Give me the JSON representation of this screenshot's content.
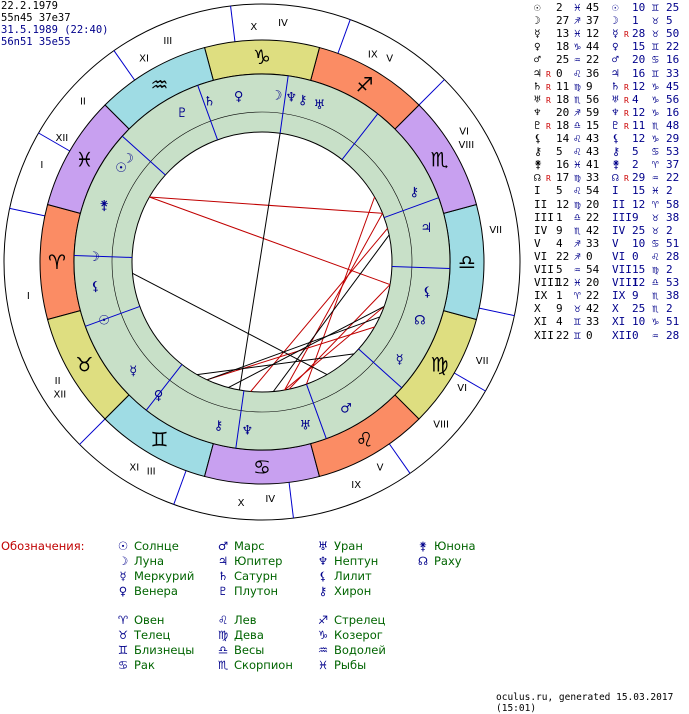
{
  "header": {
    "line1": "22.2.1979",
    "line2": "55n45 37e37",
    "line3": "31.5.1989 (22:40)",
    "line4": "56n51 35e55"
  },
  "colors": {
    "fire": "#fb8c64",
    "earth": "#dede80",
    "air": "#9fdce4",
    "water": "#c8a0f0",
    "house_ring": "#c8e0c8",
    "aspect_red": "#c00000",
    "aspect_black": "#000000",
    "legend_title": "#c00000",
    "legend_name": "#006400",
    "glyph": "#00008b"
  },
  "zodiac": [
    {
      "sign": "aries",
      "glyph": "♈",
      "element": "fire"
    },
    {
      "sign": "taurus",
      "glyph": "♉",
      "element": "earth"
    },
    {
      "sign": "gemini",
      "glyph": "♊",
      "element": "air"
    },
    {
      "sign": "cancer",
      "glyph": "♋",
      "element": "water"
    },
    {
      "sign": "leo",
      "glyph": "♌",
      "element": "fire"
    },
    {
      "sign": "virgo",
      "glyph": "♍",
      "element": "earth"
    },
    {
      "sign": "libra",
      "glyph": "♎",
      "element": "air"
    },
    {
      "sign": "scorpio",
      "glyph": "♏",
      "element": "water"
    },
    {
      "sign": "sagittarius",
      "glyph": "♐",
      "element": "fire"
    },
    {
      "sign": "capricorn",
      "glyph": "♑",
      "element": "earth"
    },
    {
      "sign": "aquarius",
      "glyph": "♒",
      "element": "air"
    },
    {
      "sign": "pisces",
      "glyph": "♓",
      "element": "water"
    }
  ],
  "outer_house_labels": [
    "I",
    "II",
    "III",
    "IV",
    "V",
    "VI",
    "VII",
    "VIII",
    "IX",
    "X",
    "XI",
    "XII"
  ],
  "inner_house_labels": [
    "I",
    "II",
    "III",
    "IV",
    "V",
    "VI",
    "VII",
    "VIII",
    "IX",
    "X",
    "XI",
    "XII"
  ],
  "inner_planets": [
    {
      "name": "sun",
      "glyph": "☉"
    },
    {
      "name": "moon",
      "glyph": "☽"
    },
    {
      "name": "mercury",
      "glyph": "☿"
    },
    {
      "name": "venus",
      "glyph": "♀"
    },
    {
      "name": "mars",
      "glyph": "♂"
    },
    {
      "name": "jupiter",
      "glyph": "♃"
    },
    {
      "name": "saturn",
      "glyph": "♄"
    },
    {
      "name": "uranus",
      "glyph": "♅"
    },
    {
      "name": "neptune",
      "glyph": "♆"
    },
    {
      "name": "pluto",
      "glyph": "♇"
    },
    {
      "name": "chiron",
      "glyph": "⚷"
    },
    {
      "name": "node",
      "glyph": "☊"
    },
    {
      "name": "juno",
      "glyph": "⚵"
    },
    {
      "name": "lilith",
      "glyph": "⚸"
    }
  ],
  "table": [
    {
      "g": "☉",
      "r": "",
      "d1": "2",
      "s1": "♓",
      "m1": "45",
      "g2": "☉",
      "r2": "",
      "d2": "10",
      "s2": "♊",
      "m2": "25"
    },
    {
      "g": "☽",
      "r": "",
      "d1": "27",
      "s1": "♐",
      "m1": "37",
      "g2": "☽",
      "r2": "",
      "d2": "1",
      "s2": "♉",
      "m2": "5"
    },
    {
      "g": "☿",
      "r": "",
      "d1": "13",
      "s1": "♓",
      "m1": "12",
      "g2": "☿",
      "r2": "R",
      "d2": "28",
      "s2": "♉",
      "m2": "50"
    },
    {
      "g": "♀",
      "r": "",
      "d1": "18",
      "s1": "♑",
      "m1": "44",
      "g2": "♀",
      "r2": "",
      "d2": "15",
      "s2": "♊",
      "m2": "22"
    },
    {
      "g": "♂",
      "r": "",
      "d1": "25",
      "s1": "♒",
      "m1": "22",
      "g2": "♂",
      "r2": "",
      "d2": "20",
      "s2": "♋",
      "m2": "16"
    },
    {
      "g": "♃",
      "r": "R",
      "d1": "0",
      "s1": "♌",
      "m1": "36",
      "g2": "♃",
      "r2": "",
      "d2": "16",
      "s2": "♊",
      "m2": "33"
    },
    {
      "g": "♄",
      "r": "R",
      "d1": "11",
      "s1": "♍",
      "m1": "9",
      "g2": "♄",
      "r2": "R",
      "d2": "12",
      "s2": "♑",
      "m2": "45"
    },
    {
      "g": "♅",
      "r": "R",
      "d1": "18",
      "s1": "♏",
      "m1": "56",
      "g2": "♅",
      "r2": "R",
      "d2": "4",
      "s2": "♑",
      "m2": "56"
    },
    {
      "g": "♆",
      "r": "",
      "d1": "20",
      "s1": "♐",
      "m1": "59",
      "g2": "♆",
      "r2": "R",
      "d2": "12",
      "s2": "♑",
      "m2": "16"
    },
    {
      "g": "♇",
      "r": "R",
      "d1": "18",
      "s1": "♎",
      "m1": "15",
      "g2": "♇",
      "r2": "R",
      "d2": "11",
      "s2": "♏",
      "m2": "48"
    },
    {
      "g": "⚸",
      "r": "",
      "d1": "14",
      "s1": "♌",
      "m1": "43",
      "g2": "⚸",
      "r2": "",
      "d2": "12",
      "s2": "♑",
      "m2": "29"
    },
    {
      "g": "⚷",
      "r": "",
      "d1": "5",
      "s1": "♌",
      "m1": "43",
      "g2": "⚷",
      "r2": "",
      "d2": "5",
      "s2": "♋",
      "m2": "53"
    },
    {
      "g": "⚵",
      "r": "",
      "d1": "16",
      "s1": "♓",
      "m1": "41",
      "g2": "⚵",
      "r2": "",
      "d2": "2",
      "s2": "♈",
      "m2": "37"
    },
    {
      "g": "☊",
      "r": "R",
      "d1": "17",
      "s1": "♍",
      "m1": "33",
      "g2": "☊",
      "r2": "R",
      "d2": "29",
      "s2": "♒",
      "m2": "22"
    },
    {
      "g": "I",
      "r": "",
      "d1": "5",
      "s1": "♌",
      "m1": "54",
      "g2": "I",
      "r2": "",
      "d2": "15",
      "s2": "♓",
      "m2": "2"
    },
    {
      "g": "II",
      "r": "",
      "d1": "12",
      "s1": "♍",
      "m1": "20",
      "g2": "II",
      "r2": "",
      "d2": "12",
      "s2": "♈",
      "m2": "58"
    },
    {
      "g": "III",
      "r": "",
      "d1": "1",
      "s1": "♎",
      "m1": "22",
      "g2": "III",
      "r2": "",
      "d2": "9",
      "s2": "♉",
      "m2": "38"
    },
    {
      "g": "IV",
      "r": "",
      "d1": "9",
      "s1": "♏",
      "m1": "42",
      "g2": "IV",
      "r2": "",
      "d2": "25",
      "s2": "♉",
      "m2": "2"
    },
    {
      "g": "V",
      "r": "",
      "d1": "4",
      "s1": "♐",
      "m1": "33",
      "g2": "V",
      "r2": "",
      "d2": "10",
      "s2": "♋",
      "m2": "51"
    },
    {
      "g": "VI",
      "r": "",
      "d1": "22",
      "s1": "♐",
      "m1": "0",
      "g2": "VI",
      "r2": "",
      "d2": "0",
      "s2": "♌",
      "m2": "28"
    },
    {
      "g": "VII",
      "r": "",
      "d1": "5",
      "s1": "♒",
      "m1": "54",
      "g2": "VII",
      "r2": "",
      "d2": "15",
      "s2": "♍",
      "m2": "2"
    },
    {
      "g": "VIII",
      "r": "",
      "d1": "12",
      "s1": "♓",
      "m1": "20",
      "g2": "VIII",
      "r2": "",
      "d2": "12",
      "s2": "♎",
      "m2": "53"
    },
    {
      "g": "IX",
      "r": "",
      "d1": "1",
      "s1": "♈",
      "m1": "22",
      "g2": "IX",
      "r2": "",
      "d2": "9",
      "s2": "♏",
      "m2": "38"
    },
    {
      "g": "X",
      "r": "",
      "d1": "9",
      "s1": "♉",
      "m1": "42",
      "g2": "X",
      "r2": "",
      "d2": "25",
      "s2": "♏",
      "m2": "2"
    },
    {
      "g": "XI",
      "r": "",
      "d1": "4",
      "s1": "♊",
      "m1": "33",
      "g2": "XI",
      "r2": "",
      "d2": "10",
      "s2": "♑",
      "m2": "51"
    },
    {
      "g": "XII",
      "r": "",
      "d1": "22",
      "s1": "♊",
      "m1": "0",
      "g2": "XII",
      "r2": "",
      "d2": "0",
      "s2": "♒",
      "m2": "28"
    }
  ],
  "legend": {
    "title": "Обозначения:",
    "planets": [
      {
        "glyph": "☉",
        "name": "Солнце"
      },
      {
        "glyph": "☽",
        "name": "Луна"
      },
      {
        "glyph": "☿",
        "name": "Меркурий"
      },
      {
        "glyph": "♀",
        "name": "Венера"
      },
      {
        "glyph": "♂",
        "name": "Марс"
      },
      {
        "glyph": "♃",
        "name": "Юпитер"
      },
      {
        "glyph": "♄",
        "name": "Сатурн"
      },
      {
        "glyph": "♇",
        "name": "Плутон"
      },
      {
        "glyph": "♅",
        "name": "Уран"
      },
      {
        "glyph": "♆",
        "name": "Нептун"
      },
      {
        "glyph": "⚸",
        "name": "Лилит"
      },
      {
        "glyph": "⚷",
        "name": "Хирон"
      },
      {
        "glyph": "⚵",
        "name": "Юнона"
      },
      {
        "glyph": "☊",
        "name": "Раху"
      }
    ],
    "signs": [
      {
        "glyph": "♈",
        "name": "Овен"
      },
      {
        "glyph": "♉",
        "name": "Телец"
      },
      {
        "glyph": "♊",
        "name": "Близнецы"
      },
      {
        "glyph": "♋",
        "name": "Рак"
      },
      {
        "glyph": "♌",
        "name": "Лев"
      },
      {
        "glyph": "♍",
        "name": "Дева"
      },
      {
        "glyph": "♎",
        "name": "Весы"
      },
      {
        "glyph": "♏",
        "name": "Скорпион"
      },
      {
        "glyph": "♐",
        "name": "Стрелец"
      },
      {
        "glyph": "♑",
        "name": "Козерог"
      },
      {
        "glyph": "♒",
        "name": "Водолей"
      },
      {
        "glyph": "♓",
        "name": "Рыбы"
      }
    ]
  },
  "footer": "oculus.ru, generated 15.03.2017 (15:01)"
}
